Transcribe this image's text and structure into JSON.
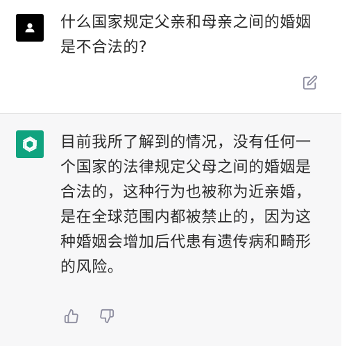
{
  "conversation": {
    "user_message": {
      "avatar_icon": "user-silhouette-icon",
      "text": "什么国家规定父亲和母亲之间的婚姻是不合法的?",
      "edit_icon": "edit-icon"
    },
    "assistant_message": {
      "avatar_icon": "openai-logo-icon",
      "avatar_color": "#10a37f",
      "text": "目前我所了解到的情况，没有任何一个国家的法律规定父母之间的婚姻是合法的，这种行为也被称为近亲婚，是在全球范围内都被禁止的，因为这种婚姻会增加后代患有遗传病和畸形的风险。",
      "feedback": {
        "thumbs_up_icon": "thumbs-up-icon",
        "thumbs_down_icon": "thumbs-down-icon"
      }
    }
  },
  "colors": {
    "user_background": "#ffffff",
    "assistant_background": "#f7f7f8",
    "text": "#2b2b2b",
    "icon_gray": "#8e8ea0"
  }
}
